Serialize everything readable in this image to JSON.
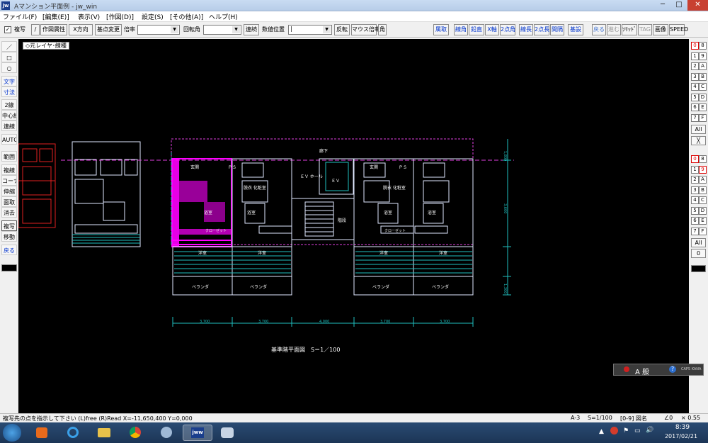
{
  "window": {
    "title": "Aマンション平面例 - jw_win",
    "app_icon": "jw",
    "min": "─",
    "max": "□",
    "close": "✕"
  },
  "menu": [
    "ファイル(F)",
    "[編集(E)]",
    "表示(V)",
    "[作図(D)]",
    "設定(S)",
    "[その他(A)]",
    "ヘルプ(H)"
  ],
  "toolbar": {
    "fukusha_check": "✓",
    "fukusha_label": "複写",
    "slash": "/",
    "sakuzu_zokusei": "作図属性",
    "x_houkou": "X方向",
    "kijunten": "基点変更",
    "bairitsu_label": "倍率",
    "bairitsu_value": "",
    "kaitenkaku_label": "回転角",
    "kaitenkaku_value": "",
    "renzoku": "連続",
    "suuchi_ichi_label": "数値位置",
    "suuchi_value": "|",
    "hanten": "反転",
    "mouse_bairitsu": "マウス倍率",
    "kaku": "角",
    "right_buttons": [
      "属取",
      "線角",
      "鉛直",
      "X軸",
      "2点角",
      "線長",
      "2点長",
      "間隔",
      "基設"
    ],
    "right_buttons2": [
      "戻る",
      "進む",
      "ｿﾘｯﾄﾞ",
      "TAG",
      "画像",
      "SPEED"
    ]
  },
  "left_tools": [
    {
      "label": "／",
      "blue": false
    },
    {
      "label": "□",
      "blue": false
    },
    {
      "label": "○",
      "blue": false
    },
    {
      "label": "文字",
      "blue": true
    },
    {
      "label": "寸法",
      "blue": true
    },
    {
      "label": "2線",
      "blue": false
    },
    {
      "label": "中心線",
      "blue": false
    },
    {
      "label": "連線",
      "blue": false
    },
    {
      "label": "AUTO",
      "blue": false
    },
    {
      "label": "範囲",
      "blue": false
    },
    {
      "label": "複線",
      "blue": false
    },
    {
      "label": "コーナー",
      "blue": false
    },
    {
      "label": "伸縮",
      "blue": false
    },
    {
      "label": "面取",
      "blue": false
    },
    {
      "label": "消去",
      "blue": false
    },
    {
      "label": "複写",
      "blue": false
    },
    {
      "label": "移動",
      "blue": false
    },
    {
      "label": "戻る",
      "blue": true
    }
  ],
  "right_layer_groups": [
    [
      "0",
      "8"
    ],
    [
      "1",
      "9"
    ],
    [
      "2",
      "A"
    ],
    [
      "3",
      "B"
    ],
    [
      "4",
      "C"
    ],
    [
      "5",
      "D"
    ],
    [
      "6",
      "E"
    ],
    [
      "7",
      "F"
    ]
  ],
  "right_all": "All",
  "right_x": "╳",
  "right_layers": [
    [
      "0",
      "8"
    ],
    [
      "1",
      "9"
    ],
    [
      "2",
      "A"
    ],
    [
      "3",
      "B"
    ],
    [
      "4",
      "C"
    ],
    [
      "5",
      "D"
    ],
    [
      "6",
      "E"
    ],
    [
      "7",
      "F"
    ]
  ],
  "right_all2": "All",
  "right_zero": "0",
  "canvas": {
    "layer_label": "◇元レイヤ･線種",
    "drawing_title": "基準階平面図　S＝1／100",
    "labels": {
      "roka": "廊下",
      "ev_hall": "ＥＶ\nホール",
      "ev": "ＥＶ",
      "kaidan": "階段",
      "genkan": "玄関",
      "ps": "ＰＳ",
      "senmen": "脱衣\n化粧室",
      "yokushitsu": "浴室",
      "kitchen": "キッチン",
      "closet": "クローゼット",
      "yoshitsu": "洋室",
      "veranda": "ベランダ"
    },
    "dims": [
      "3,700",
      "3,700",
      "4,000",
      "3,700",
      "3,700"
    ],
    "vdims": [
      "1,800",
      "3,600",
      "1,300"
    ]
  },
  "ime": {
    "label": "A 般",
    "mode": "CAPS KANA"
  },
  "status": {
    "message": "複写先の点を指示して下さい (L)free (R)Read X=-11,650,400 Y=0,000",
    "layer": "A-3",
    "scale": "S=1/100",
    "group": "[0-9] 図名",
    "angle": "∠0",
    "ratio": "× 0.55"
  },
  "clock": {
    "time": "8:39",
    "date": "2017/02/21"
  }
}
